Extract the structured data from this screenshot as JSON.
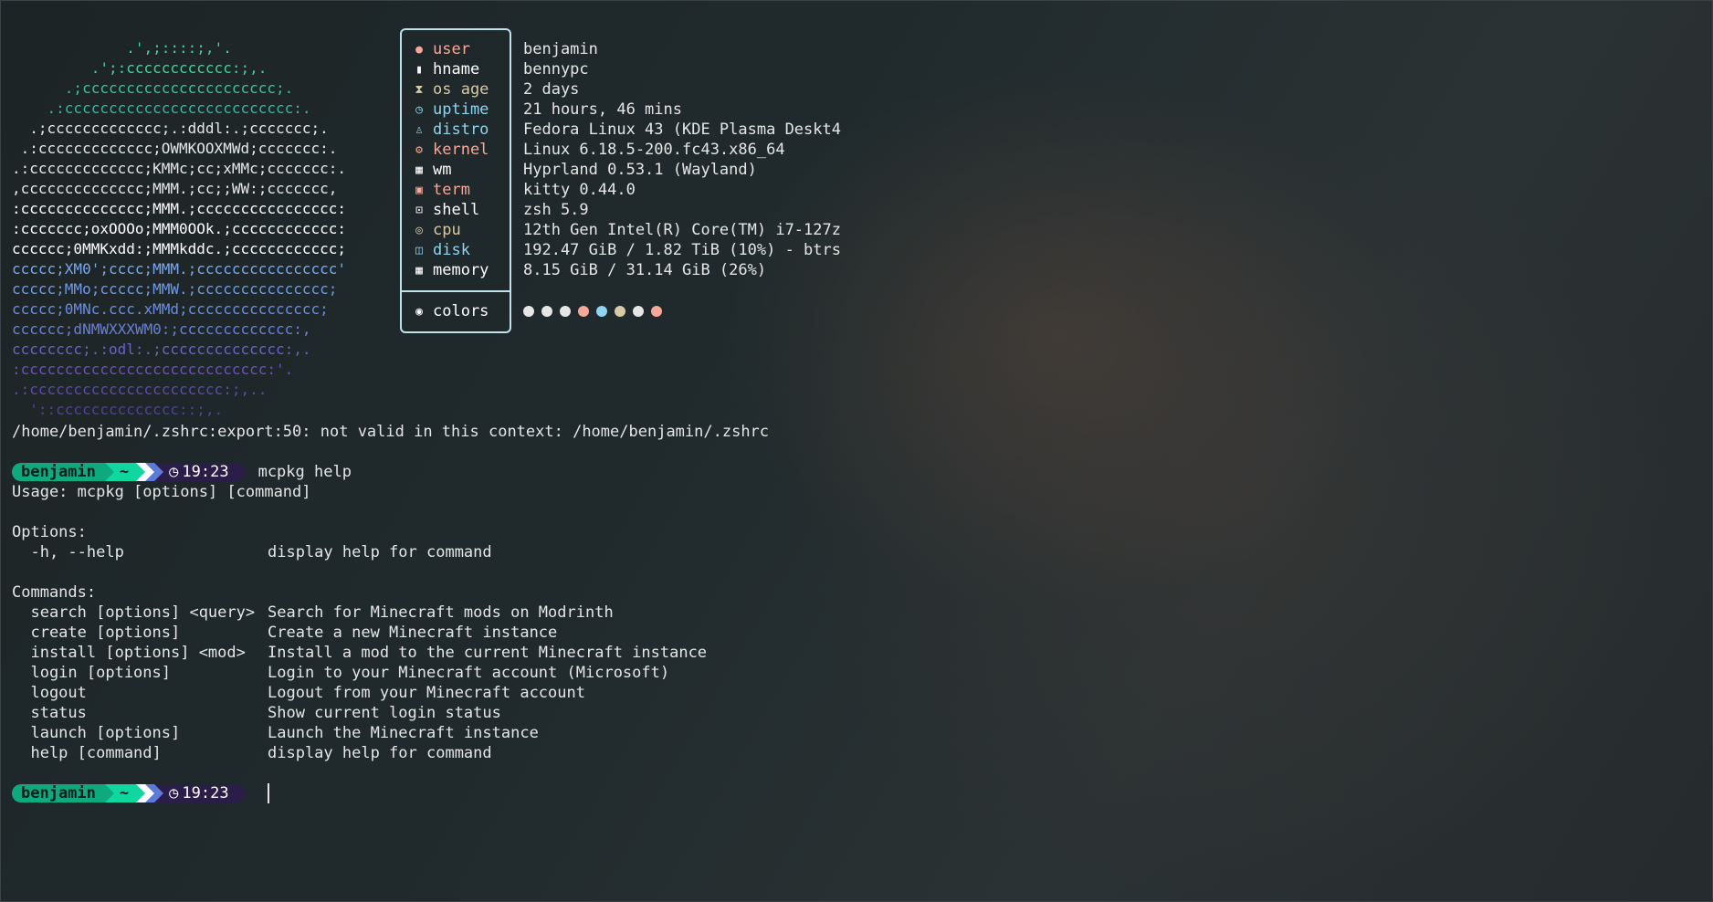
{
  "ascii_art": [
    {
      "text": "             .',;::::;,'.",
      "color": "#3fd49a"
    },
    {
      "text": "         .';:cccccccccccc:;,.",
      "color": "#3fd49a"
    },
    {
      "text": "      .;cccccccccccccccccccccc;.",
      "color": "#38c29a"
    },
    {
      "text": "    .:cccccccccccccccccccccccccc:.",
      "color": "#35b8a0"
    },
    {
      "text": "  .;ccccccccccccc;.:dddl:.;ccccccc;.",
      "color": "#e8e8e8"
    },
    {
      "text": " .:ccccccccccccc;OWMKOOXMWd;ccccccc:.",
      "color": "#e8e8e8"
    },
    {
      "text": ".:ccccccccccccc;KMMc;cc;xMMc;ccccccc:.",
      "color": "#e8e8e8"
    },
    {
      "text": ",cccccccccccccc;MMM.;cc;;WW:;ccccccc,",
      "color": "#e8e8e8"
    },
    {
      "text": ":cccccccccccccc;MMM.;cccccccccccccccc:",
      "color": "#ffffff"
    },
    {
      "text": ":ccccccc;oxOOOo;MMM0OOk.;cccccccccccc:",
      "color": "#ffffff"
    },
    {
      "text": "cccccc;0MMKxdd:;MMMkddc.;cccccccccccc;",
      "color": "#ffffff"
    },
    {
      "text": "ccccc;XM0';cccc;MMM.;cccccccccccccccc'",
      "color": "#7aa8f0"
    },
    {
      "text": "ccccc;MMo;ccccc;MMW.;ccccccccccccccc;",
      "color": "#6f9ae6"
    },
    {
      "text": "ccccc;0MNc.ccc.xMMd;ccccccccccccccc;",
      "color": "#6a8ee0"
    },
    {
      "text": "cccccc;dNMWXXXWM0:;ccccccccccccc:,",
      "color": "#6a7fd8"
    },
    {
      "text": "cccccccc;.:odl:.;cccccccccccccc:,.",
      "color": "#6b62c8"
    },
    {
      "text": ":cccccccccccccccccccccccccccc:'.",
      "color": "#6a52b8"
    },
    {
      "text": ".:cccccccccccccccccccccc:;,..",
      "color": "#5e4aa8"
    },
    {
      "text": "  '::cccccccccccccc::;,.",
      "color": "#52409a"
    }
  ],
  "fetch": {
    "rows": [
      {
        "label": "user",
        "value": "benjamin",
        "icon": "user-icon",
        "glyph": "●",
        "color": "#f6a89a"
      },
      {
        "label": "hname",
        "value": "bennypc",
        "icon": "computer-icon",
        "glyph": "▮",
        "color": "#ffffff"
      },
      {
        "label": "os age",
        "value": "2 days",
        "icon": "hourglass-icon",
        "glyph": "⧗",
        "color": "#d8c9a8"
      },
      {
        "label": "uptime",
        "value": "21 hours, 46 mins",
        "icon": "clock-icon",
        "glyph": "◷",
        "color": "#8fd4f0"
      },
      {
        "label": "distro",
        "value": "Fedora Linux 43 (KDE Plasma Deskt4",
        "icon": "linux-icon",
        "glyph": "♙",
        "color": "#8fd4f0"
      },
      {
        "label": "kernel",
        "value": "Linux 6.18.5-200.fc43.x86_64",
        "icon": "gear-icon",
        "glyph": "⚙",
        "color": "#f6a89a"
      },
      {
        "label": "wm",
        "value": "Hyprland 0.53.1 (Wayland)",
        "icon": "keyboard-icon",
        "glyph": "▦",
        "color": "#ffffff"
      },
      {
        "label": "term",
        "value": "kitty 0.44.0",
        "icon": "terminal-red-icon",
        "glyph": "▣",
        "color": "#f6a89a"
      },
      {
        "label": "shell",
        "value": "zsh 5.9",
        "icon": "shell-icon",
        "glyph": "⊡",
        "color": "#ffffff"
      },
      {
        "label": "cpu",
        "value": "12th Gen Intel(R) Core(TM) i7-127z",
        "icon": "cpu-icon",
        "glyph": "◎",
        "color": "#d8c9a8"
      },
      {
        "label": "disk",
        "value": "192.47 GiB / 1.82 TiB (10%) - btrs",
        "icon": "disk-icon",
        "glyph": "◫",
        "color": "#8fd4f0"
      },
      {
        "label": "memory",
        "value": "8.15 GiB / 31.14 GiB (26%)",
        "icon": "memory-icon",
        "glyph": "▦",
        "color": "#ffffff"
      }
    ],
    "colors_label": "colors",
    "palette": [
      "#e6e6e6",
      "#e6e6e6",
      "#e6e6e6",
      "#f6a89a",
      "#8fd4f0",
      "#d8c9a8",
      "#e6e6e6",
      "#f6a89a"
    ]
  },
  "warning": "/home/benjamin/.zshrc:export:50: not valid in this context: /home/benjamin/.zshrc",
  "prompt": {
    "user": "benjamin",
    "dir": "~",
    "time": "19:23"
  },
  "command": "mcpkg help",
  "output": {
    "usage": "Usage: mcpkg [options] [command]",
    "options_header": "Options:",
    "options": [
      {
        "flag": "  -h, --help",
        "desc": "display help for command"
      }
    ],
    "commands_header": "Commands:",
    "commands": [
      {
        "cmd": "  search [options] <query>",
        "desc": "Search for Minecraft mods on Modrinth"
      },
      {
        "cmd": "  create [options]",
        "desc": "Create a new Minecraft instance"
      },
      {
        "cmd": "  install [options] <mod>",
        "desc": "Install a mod to the current Minecraft instance"
      },
      {
        "cmd": "  login [options]",
        "desc": "Login to your Minecraft account (Microsoft)"
      },
      {
        "cmd": "  logout",
        "desc": "Logout from your Minecraft account"
      },
      {
        "cmd": "  status",
        "desc": "Show current login status"
      },
      {
        "cmd": "  launch [options]",
        "desc": "Launch the Minecraft instance"
      },
      {
        "cmd": "  help [command]",
        "desc": "display help for command"
      }
    ]
  }
}
